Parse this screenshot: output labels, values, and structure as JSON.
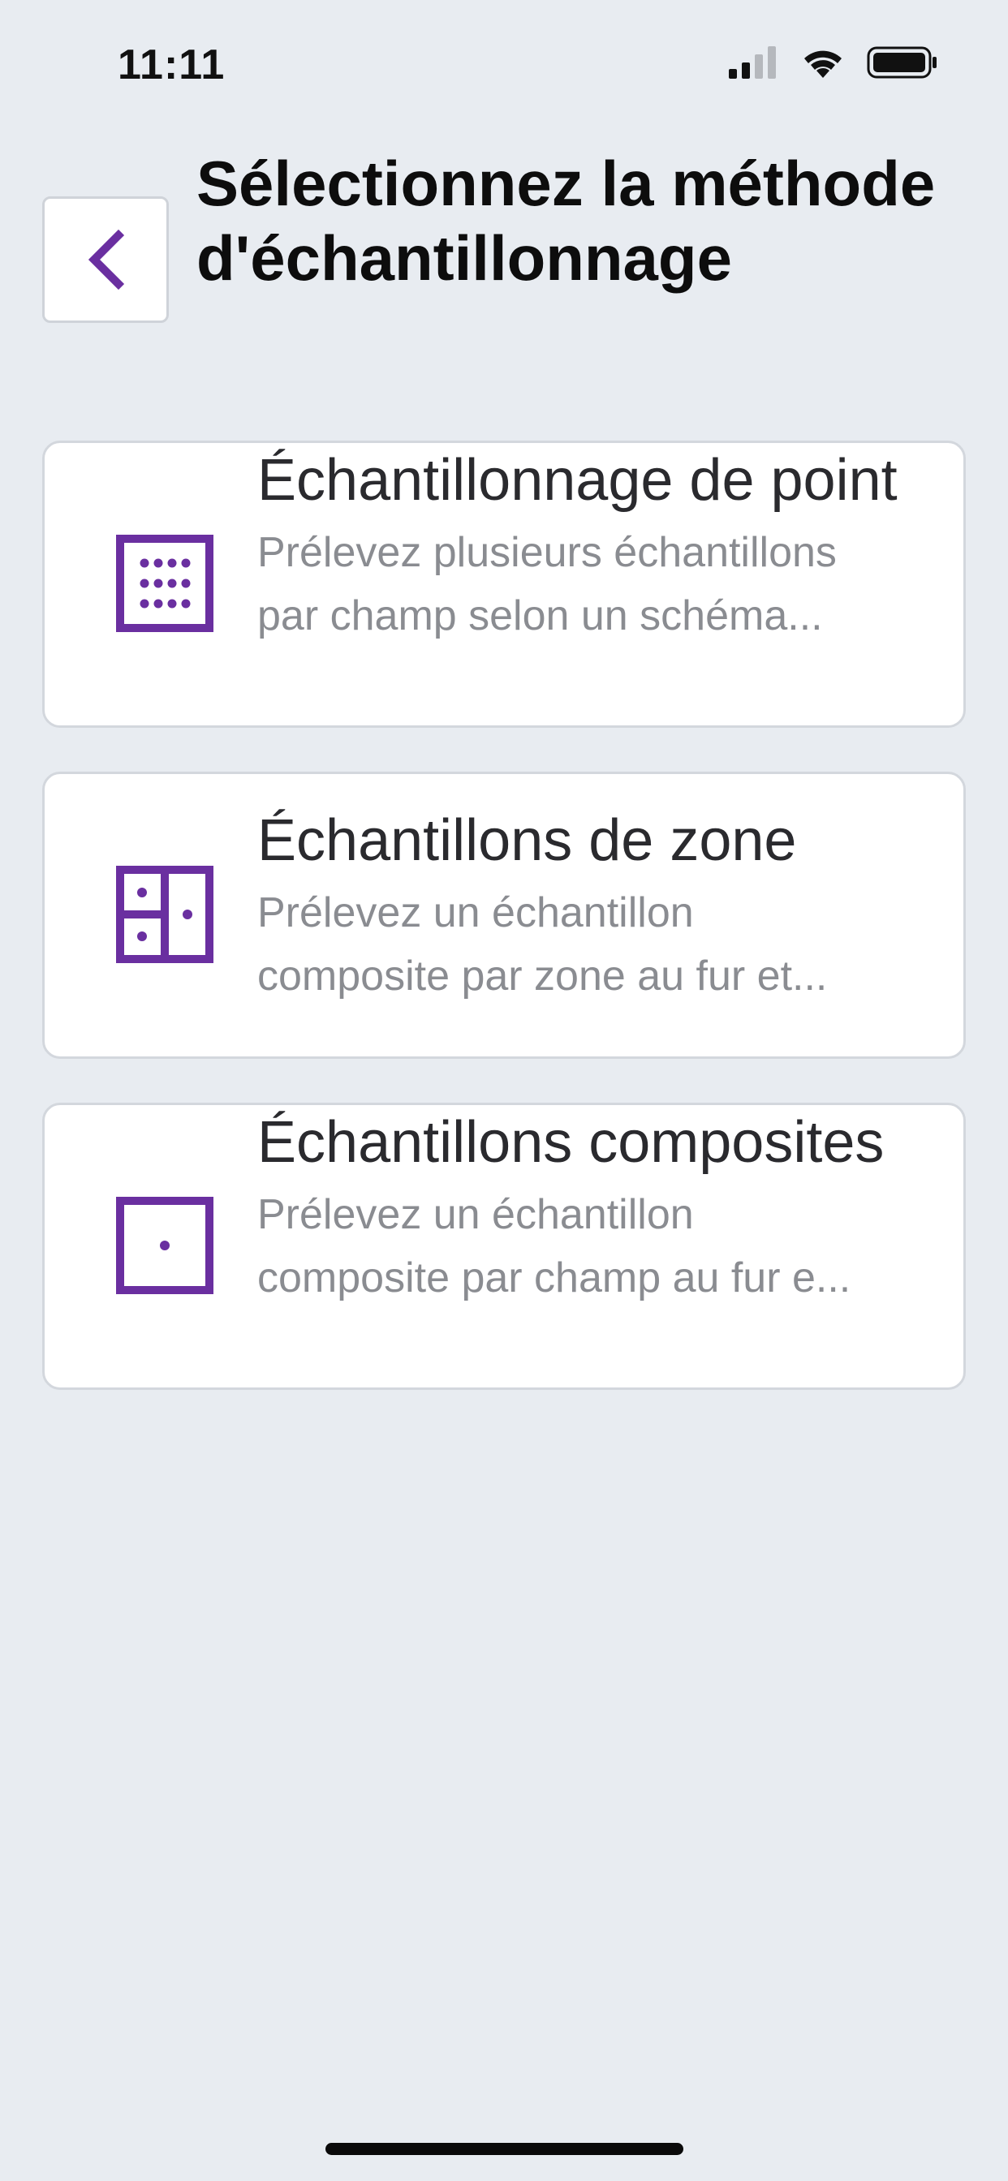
{
  "status_bar": {
    "time": "11:11",
    "signal_icon": "cellular-signal-icon",
    "wifi_icon": "wifi-icon",
    "battery_icon": "battery-icon"
  },
  "header": {
    "back_icon": "chevron-left-icon",
    "title": "Sélectionnez la méthode d'échantillonnage"
  },
  "methods": [
    {
      "icon": "point-grid-icon",
      "title": "Échantillonnage de point",
      "desc_line1": "Prélevez plusieurs échantillons",
      "desc_line2": "par champ selon un schéma..."
    },
    {
      "icon": "zone-grid-icon",
      "title": "Échantillons de zone",
      "desc_line1": "Prélevez un échantillon",
      "desc_line2": "composite par zone au fur et..."
    },
    {
      "icon": "single-point-icon",
      "title": "Échantillons composites",
      "desc_line1": "Prélevez un échantillon",
      "desc_line2": "composite par champ au fur e..."
    }
  ],
  "colors": {
    "accent": "#6a2fa0",
    "background": "#e8ecf1",
    "card": "#ffffff",
    "secondary_text": "#8a8c91"
  }
}
